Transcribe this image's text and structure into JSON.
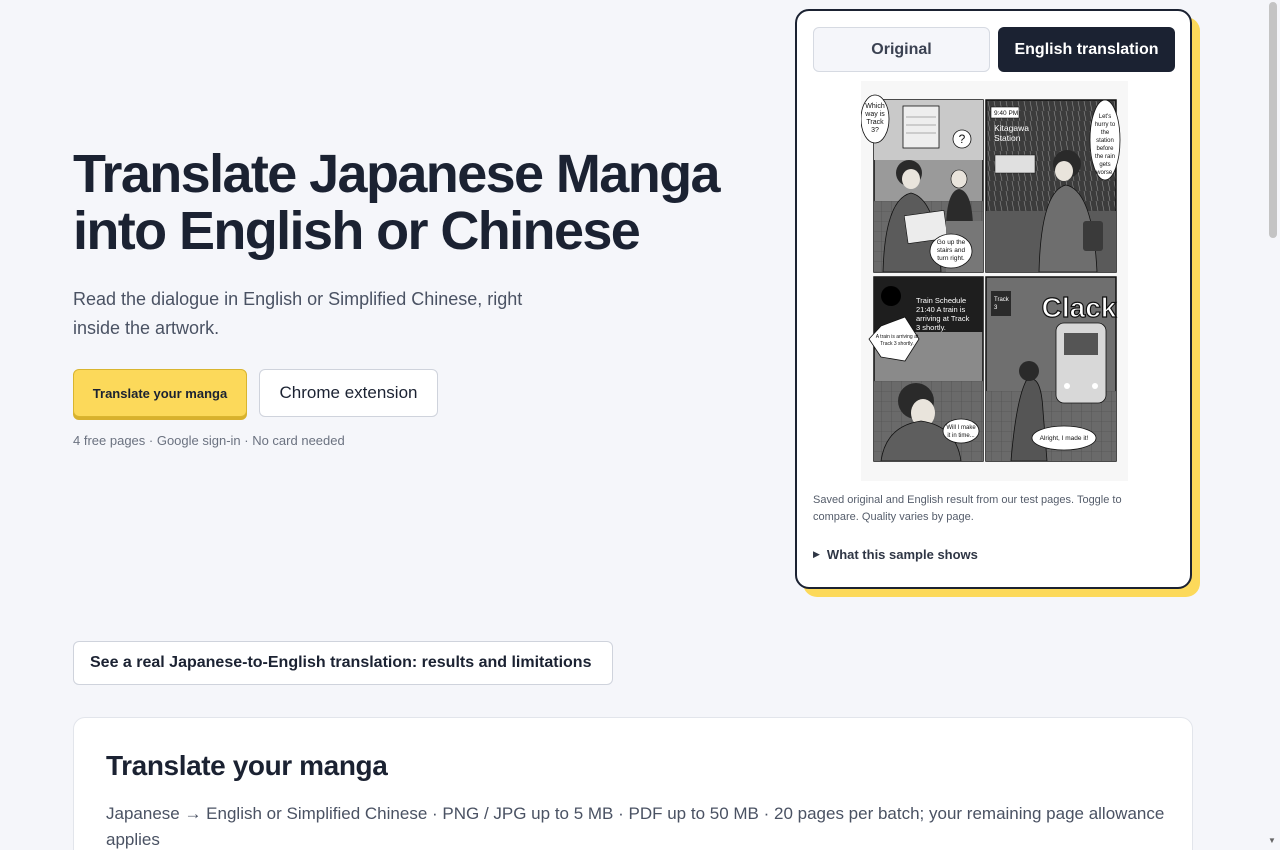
{
  "hero": {
    "title_line1": "Translate Japanese Manga",
    "title_line2": "into English or Chinese",
    "subtitle": "Read the dialogue in English or Simplified Chinese, right inside the artwork.",
    "primary_cta": "Translate your manga",
    "secondary_cta": "Chrome extension",
    "note": "4 free pages · Google sign-in · No card needed"
  },
  "sample_card": {
    "tabs": [
      {
        "label": "Original",
        "selected": false
      },
      {
        "label": "English translation",
        "selected": true
      }
    ],
    "caption": "Saved original and English result from our test pages. Toggle to compare. Quality varies by page.",
    "details_label": "What this sample shows",
    "manga": {
      "panel1_bubble": "Which way is Track 3?",
      "panel1_reply": "Go up the stairs and turn right.",
      "panel1_question": "?",
      "panel2_time": "9:40 PM",
      "panel2_station": "Kitagawa Station",
      "panel2_bubble": "Let's hurry to the station before the rain gets worse.",
      "panel3_board": "Train Schedule 21:40 A train is arriving at Track 3 shortly.",
      "panel3_bubble": "A train is arriving at Track 3 shortly.",
      "panel3_thought": "Will I make it in time...",
      "panel4_sfx": "Clack",
      "panel4_sign": "Track 3",
      "panel4_bubble": "Alright, I made it!"
    }
  },
  "results_link": "See a real Japanese-to-English translation: results and limitations",
  "upload_panel": {
    "title": "Translate your manga",
    "subtitle": "Japanese → English or Simplified Chinese · PNG / JPG up to 5 MB · PDF up to 50 MB · 20 pages per batch; your remaining page allowance applies"
  },
  "colors": {
    "accent": "#fcd95a",
    "ink": "#1b2232",
    "background": "#f5f6fa"
  }
}
